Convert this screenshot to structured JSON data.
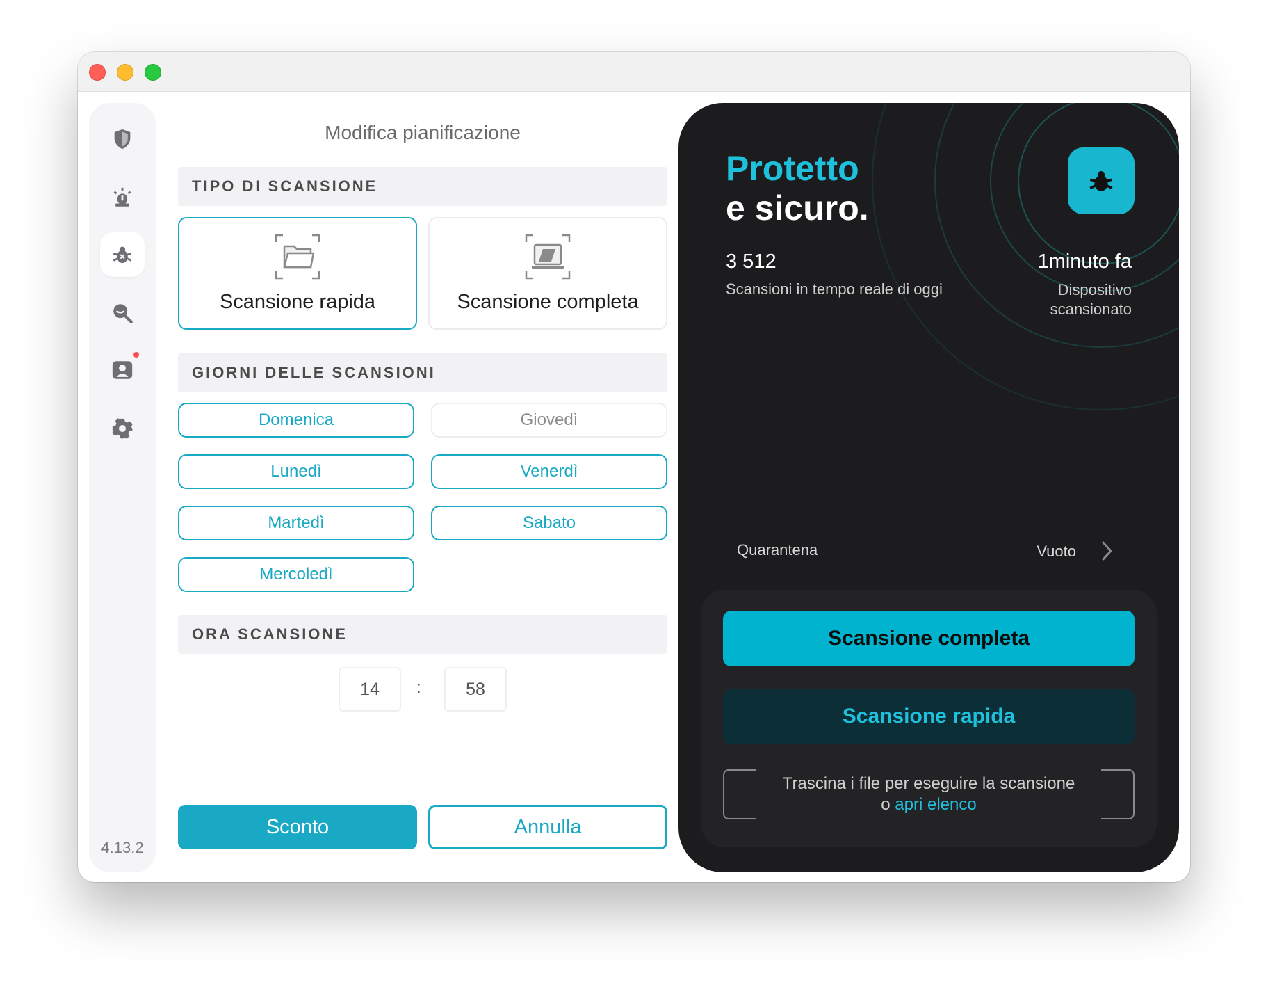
{
  "window": {
    "traffic_lights": [
      "close",
      "minimize",
      "zoom"
    ]
  },
  "sidebar": {
    "items": [
      {
        "name": "shield-icon",
        "active": false
      },
      {
        "name": "alarm-icon",
        "active": false
      },
      {
        "name": "bug-icon",
        "active": true
      },
      {
        "name": "search-icon",
        "active": false
      },
      {
        "name": "account-icon",
        "active": false,
        "badge": true
      },
      {
        "name": "gear-icon",
        "active": false
      }
    ],
    "version": "4.13.2"
  },
  "schedule": {
    "title": "Modifica pianificazione",
    "scan_type_header": "TIPO DI SCANSIONE",
    "scan_types": [
      {
        "label": "Scansione rapida",
        "selected": true
      },
      {
        "label": "Scansione completa",
        "selected": false
      }
    ],
    "days_header": "GIORNI DELLE SCANSIONI",
    "days": [
      {
        "label": "Domenica",
        "selected": true
      },
      {
        "label": "Lunedì",
        "selected": true
      },
      {
        "label": "Martedì",
        "selected": true
      },
      {
        "label": "Mercoledì",
        "selected": true
      },
      {
        "label": "Giovedì",
        "selected": false
      },
      {
        "label": "Venerdì",
        "selected": true
      },
      {
        "label": "Sabato",
        "selected": true
      }
    ],
    "time_header": "ORA SCANSIONE",
    "hour": "14",
    "separator": ":",
    "minute": "58",
    "confirm_label": "Sconto",
    "cancel_label": "Annulla"
  },
  "status": {
    "headline_accent": "Protetto",
    "headline": "e sicuro.",
    "scans_count": "3 512",
    "scans_label": "Scansioni in tempo reale di oggi",
    "last_scan_time": "1minuto fa",
    "last_scan_label": "Dispositivo scansionato",
    "quarantine_label": "Quarantena",
    "quarantine_value": "Vuoto",
    "full_scan_label": "Scansione completa",
    "quick_scan_label": "Scansione rapida",
    "drop_text": "Trascina i file per eseguire la scansione",
    "drop_or": "o",
    "drop_link": "apri elenco"
  },
  "colors": {
    "accent": "#1aa9c4",
    "accent_bright": "#1fc0db",
    "dark_bg": "#1c1c1e"
  }
}
